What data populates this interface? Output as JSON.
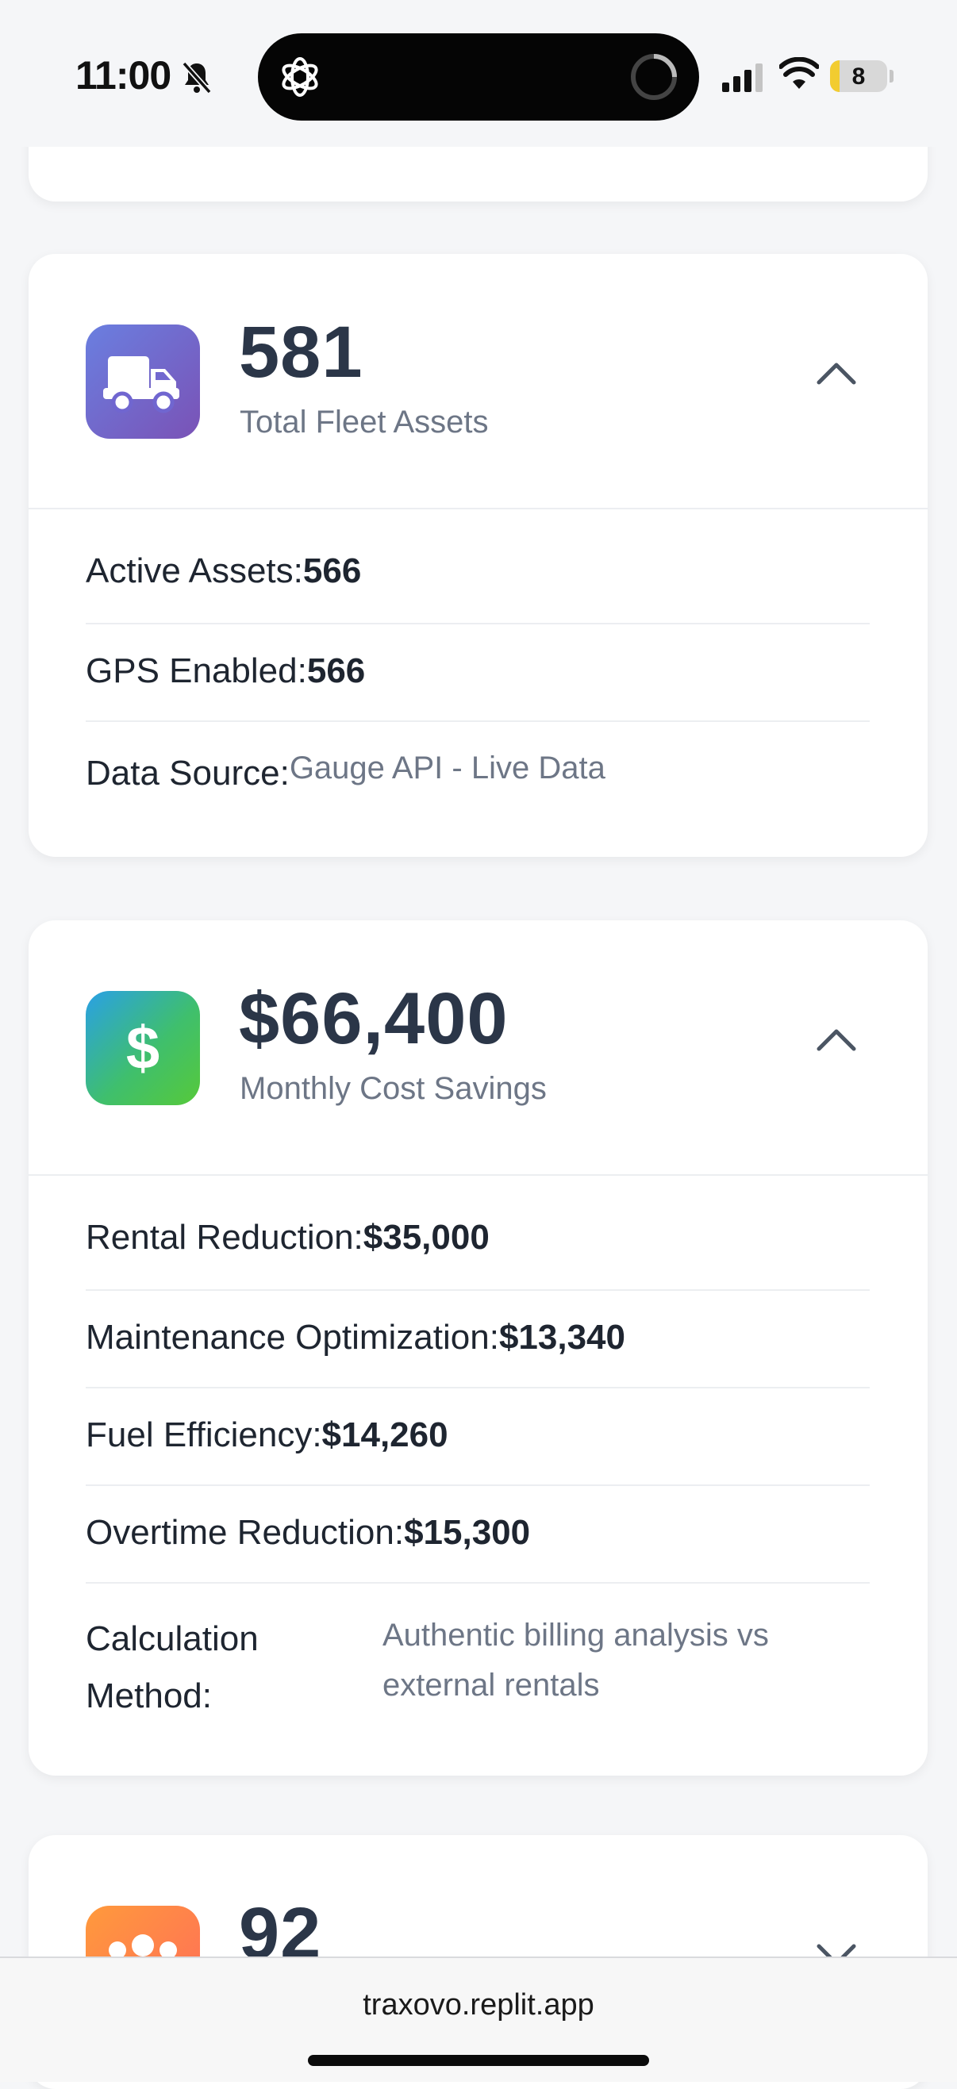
{
  "status_bar": {
    "time": "11:00",
    "battery": "8"
  },
  "cards": {
    "fleet": {
      "value": "581",
      "label": "Total Fleet Assets",
      "rows": [
        {
          "label": "Active Assets:",
          "value": "566"
        },
        {
          "label": "GPS Enabled:",
          "value": "566"
        },
        {
          "label": "Data Source:",
          "value": "Gauge API - Live Data"
        }
      ]
    },
    "savings": {
      "value": "$66,400",
      "label": "Monthly Cost Savings",
      "rows": [
        {
          "label": "Rental Reduction:",
          "value": "$35,000"
        },
        {
          "label": "Maintenance Optimization:",
          "value": "$13,340"
        },
        {
          "label": "Fuel Efficiency:",
          "value": "$14,260"
        },
        {
          "label": "Overtime Reduction:",
          "value": "$15,300"
        },
        {
          "label": "Calculation Method:",
          "value": "Authentic billing analysis vs external rentals"
        }
      ]
    },
    "third": {
      "value": "92"
    }
  },
  "browser": {
    "url": "traxovo.replit.app"
  },
  "colors": {
    "fleet_icon": "#7b5fc4",
    "savings_icon": "#38b86a",
    "third_icon": "#ff8a4c",
    "title": "#2b3648"
  },
  "icons": [
    "bell-slash-icon",
    "chatgpt-icon",
    "truck-icon",
    "dollar-icon",
    "people-icon",
    "chevron-up-icon",
    "chevron-down-icon"
  ]
}
